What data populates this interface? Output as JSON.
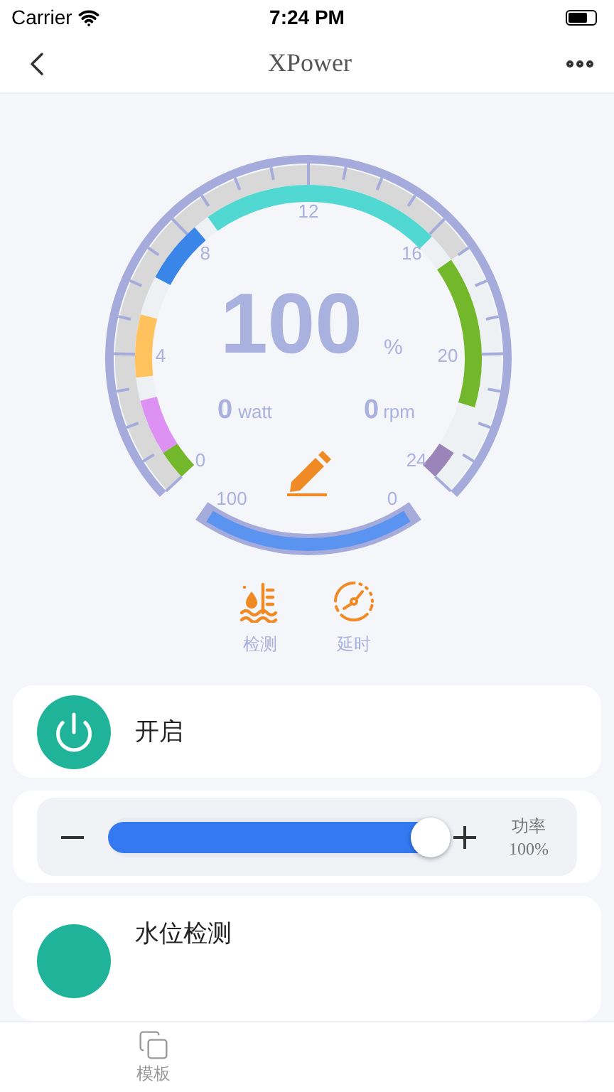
{
  "status_bar": {
    "carrier": "Carrier",
    "time": "7:24 PM"
  },
  "nav": {
    "title": "XPower"
  },
  "gauge": {
    "value": "100",
    "unit": "%",
    "scale_labels": [
      "0",
      "4",
      "8",
      "12",
      "16",
      "20",
      "24"
    ],
    "power": {
      "value": "0",
      "unit": "watt"
    },
    "speed": {
      "value": "0",
      "unit": "rpm"
    },
    "range_labels": [
      "100",
      "0"
    ]
  },
  "actions": [
    {
      "kind": "water",
      "label": "检测"
    },
    {
      "kind": "timer",
      "label": "延时"
    }
  ],
  "switch_card": {
    "label": "开启"
  },
  "power_slider": {
    "level": 1,
    "label": "功率",
    "reading": "100%"
  },
  "water_card": {
    "label": "水位检测"
  },
  "tab_bar": [
    {
      "label": "模板",
      "selected": false
    }
  ]
}
